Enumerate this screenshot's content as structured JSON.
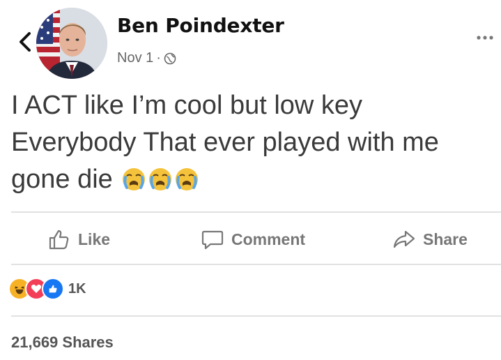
{
  "post": {
    "author": "Ben Poindexter",
    "date": "Nov 1",
    "separator": "·",
    "lines": [
      "I ACT like I’m cool but low key",
      "Everybody That ever played with me",
      "gone die"
    ],
    "inline_emojis": [
      "crying-emoji",
      "crying-emoji",
      "crying-emoji"
    ]
  },
  "actions": {
    "like_label": "Like",
    "comment_label": "Comment",
    "share_label": "Share"
  },
  "reactions": {
    "types": [
      "haha",
      "love",
      "like"
    ],
    "count": "1K"
  },
  "shares_text": "21,669 Shares",
  "colors": {
    "like_blue": "#1877f2",
    "love_red": "#f33e58",
    "haha_yellow": "#f7b125",
    "text_gray": "#777777"
  }
}
